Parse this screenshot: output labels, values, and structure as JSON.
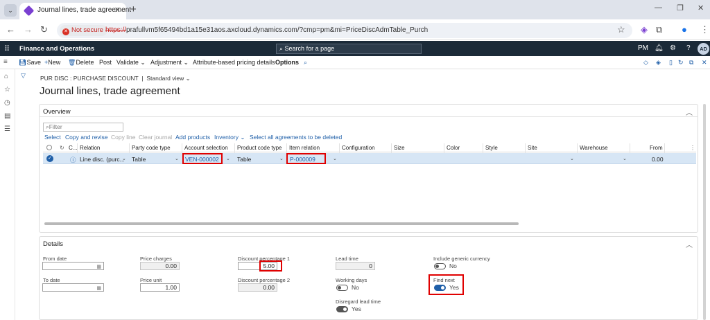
{
  "browser": {
    "tab_title": "Journal lines, trade agreement",
    "not_secure": "Not secure",
    "url_protocol": "https://",
    "url_rest": "prafullvm5f65494bd1a15e31aos.axcloud.dynamics.com/?cmp=pm&mi=PriceDiscAdmTable_Purch"
  },
  "app": {
    "name": "Finance and Operations",
    "search_placeholder": "Search for a page",
    "company": "PM",
    "user_initials": "AD"
  },
  "actions": {
    "save": "Save",
    "new": "New",
    "delete": "Delete",
    "post": "Post",
    "validate": "Validate",
    "adjustment": "Adjustment",
    "attribute_pricing": "Attribute-based pricing details",
    "options": "Options"
  },
  "page": {
    "breadcrumb": "PUR DISC : PURCHASE DISCOUNT",
    "separator": "|",
    "view": "Standard view",
    "title": "Journal lines, trade agreement"
  },
  "overview": {
    "header": "Overview",
    "filter_placeholder": "Filter",
    "toolbar": {
      "select": "Select",
      "copy_revise": "Copy and revise",
      "copy_line": "Copy line",
      "clear_journal": "Clear journal",
      "add_products": "Add products",
      "inventory": "Inventory",
      "select_all": "Select all agreements to be deleted"
    },
    "columns": {
      "c": "C...",
      "relation": "Relation",
      "party_code_type": "Party code type",
      "account_selection": "Account selection",
      "product_code_type": "Product code type",
      "item_relation": "Item relation",
      "configuration": "Configuration",
      "size": "Size",
      "color": "Color",
      "style": "Style",
      "site": "Site",
      "warehouse": "Warehouse",
      "from": "From"
    },
    "row": {
      "relation": "Line disc. (purc...",
      "party_code_type": "Table",
      "account_selection": "VEN-000002",
      "product_code_type": "Table",
      "item_relation": "P-000009",
      "from": "0.00"
    }
  },
  "details": {
    "header": "Details",
    "from_date_label": "From date",
    "to_date_label": "To date",
    "price_charges_label": "Price charges",
    "price_charges": "0.00",
    "price_unit_label": "Price unit",
    "price_unit": "1.00",
    "discount_pct1_label": "Discount percentage 1",
    "discount_pct1": "5.00",
    "discount_pct2_label": "Discount percentage 2",
    "discount_pct2": "0.00",
    "lead_time_label": "Lead time",
    "lead_time": "0",
    "working_days_label": "Working days",
    "working_days": "No",
    "disregard_lead_time_label": "Disregard lead time",
    "disregard_lead_time": "Yes",
    "include_generic_currency_label": "Include generic currency",
    "include_generic_currency": "No",
    "find_next_label": "Find next",
    "find_next": "Yes"
  },
  "colors": {
    "app_header": "#1b2a38",
    "accent": "#1f5fa8",
    "highlight_box": "#e00000",
    "selected_row": "#d7e6f5"
  },
  "icons": [
    "waffle-icon",
    "search-icon",
    "bell-icon",
    "gear-icon",
    "help-icon",
    "home-icon",
    "star-icon",
    "clock-icon",
    "workspace-icon",
    "list-icon",
    "filter-icon",
    "calendar-icon",
    "refresh-icon",
    "info-icon"
  ]
}
